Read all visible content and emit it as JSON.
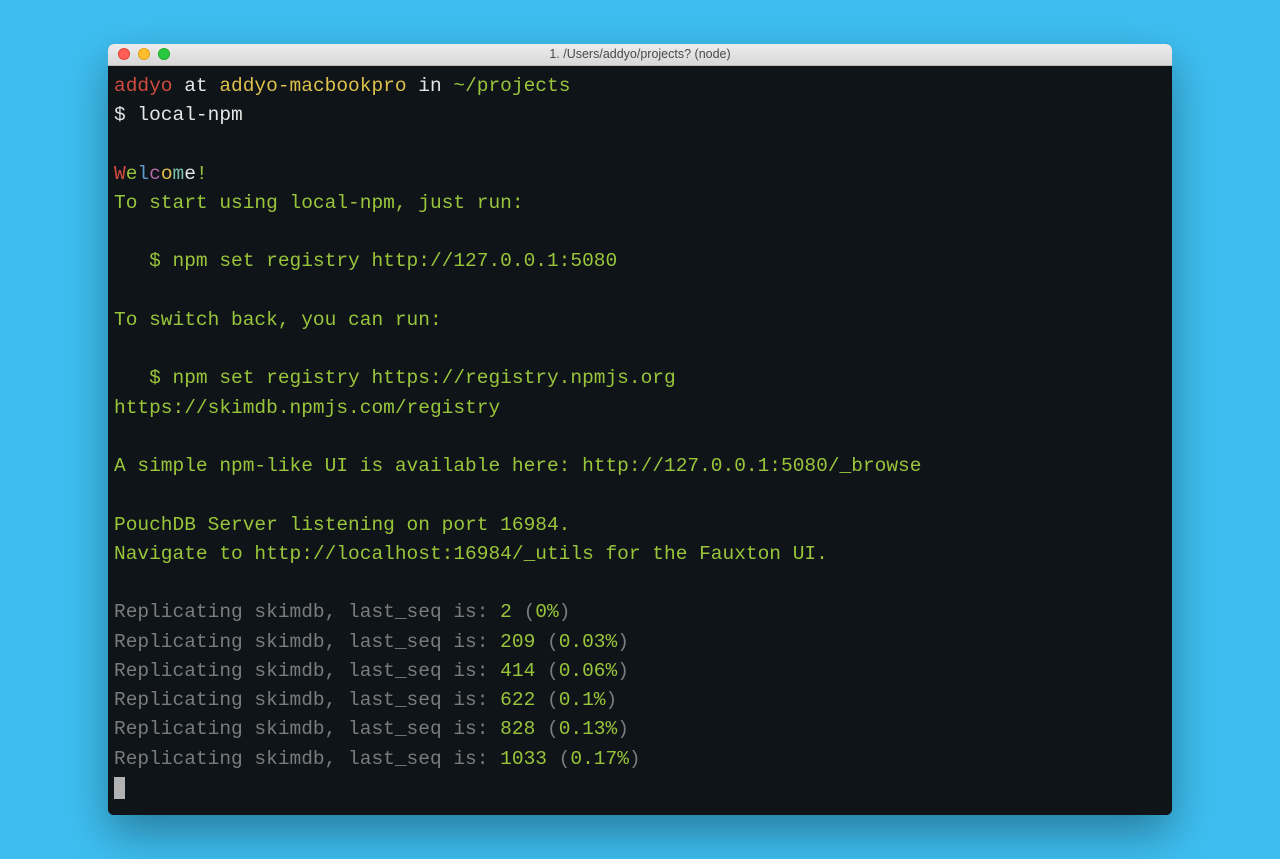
{
  "window": {
    "title": "1. /Users/addyo/projects? (node)"
  },
  "prompt": {
    "user": "addyo",
    "at": " at ",
    "host": "addyo-macbookpro",
    "in": " in ",
    "path": "~/projects",
    "symbol": "$ ",
    "command": "local-npm"
  },
  "welcome": {
    "chars": [
      "W",
      "e",
      "l",
      "c",
      "o",
      "m",
      "e"
    ],
    "bang": "!"
  },
  "messages": {
    "start_line": "To start using local-npm, just run:",
    "set_registry_local": "   $ npm set registry http://127.0.0.1:5080",
    "switch_back": "To switch back, you can run:",
    "set_registry_npm": "   $ npm set registry https://registry.npmjs.org",
    "skimdb_url": "https://skimdb.npmjs.com/registry",
    "ui_line": "A simple npm-like UI is available here: http://127.0.0.1:5080/_browse",
    "pouch_line": "PouchDB Server listening on port 16984.",
    "fauxton_line": "Navigate to http://localhost:16984/_utils for the Fauxton UI."
  },
  "replication": {
    "label_prefix": "Replicating skimdb, last_seq is: ",
    "rows": [
      {
        "seq": "2",
        "pct": "0%"
      },
      {
        "seq": "209",
        "pct": "0.03%"
      },
      {
        "seq": "414",
        "pct": "0.06%"
      },
      {
        "seq": "622",
        "pct": "0.1%"
      },
      {
        "seq": "828",
        "pct": "0.13%"
      },
      {
        "seq": "1033",
        "pct": "0.17%"
      }
    ]
  }
}
